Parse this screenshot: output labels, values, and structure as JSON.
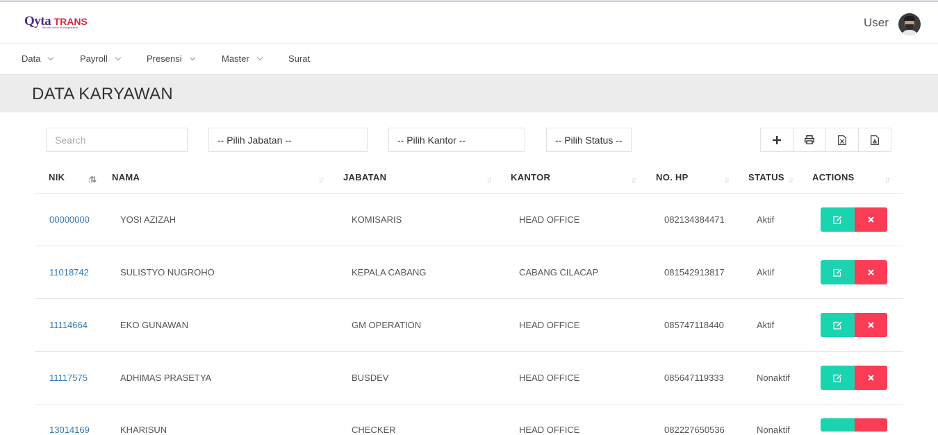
{
  "brand": {
    "name_part1": "Qyta",
    "name_part2": "TRANS",
    "tagline": "the best choice of transportation"
  },
  "header": {
    "user_label": "User"
  },
  "nav": [
    {
      "label": "Data"
    },
    {
      "label": "Payroll"
    },
    {
      "label": "Presensi"
    },
    {
      "label": "Master"
    },
    {
      "label": "Surat"
    }
  ],
  "page": {
    "title": "DATA KARYAWAN"
  },
  "filters": {
    "search_placeholder": "Search",
    "jabatan": "-- Pilih Jabatan --",
    "kantor": "-- Pilih Kantor --",
    "status": "-- Pilih Status --"
  },
  "toolbar": [
    "plus-icon",
    "print-icon",
    "excel-icon",
    "pdf-icon"
  ],
  "table": {
    "columns": [
      "NIK",
      "NAMA",
      "JABATAN",
      "KANTOR",
      "NO. HP",
      "STATUS",
      "ACTIONS"
    ],
    "rows": [
      {
        "nik": "00000000",
        "nama": "YOSI AZIZAH",
        "jabatan": "KOMISARIS",
        "kantor": "HEAD OFFICE",
        "hp": "082134384471",
        "status": "Aktif"
      },
      {
        "nik": "11018742",
        "nama": "SULISTYO NUGROHO",
        "jabatan": "KEPALA CABANG",
        "kantor": "CABANG CILACAP",
        "hp": "081542913817",
        "status": "Aktif"
      },
      {
        "nik": "11114664",
        "nama": "EKO GUNAWAN",
        "jabatan": "GM OPERATION",
        "kantor": "HEAD OFFICE",
        "hp": "085747118440",
        "status": "Aktif"
      },
      {
        "nik": "11117575",
        "nama": "ADHIMAS PRASETYA",
        "jabatan": "BUSDEV",
        "kantor": "HEAD OFFICE",
        "hp": "085647119333",
        "status": "Nonaktif"
      },
      {
        "nik": "13014169",
        "nama": "KHARISUN",
        "jabatan": "CHECKER",
        "kantor": "HEAD OFFICE",
        "hp": "082227650536",
        "status": "Nonaktif"
      }
    ]
  },
  "colors": {
    "accent_edit": "#19d4ae",
    "accent_delete": "#fa3c55",
    "link": "#337ab7"
  }
}
